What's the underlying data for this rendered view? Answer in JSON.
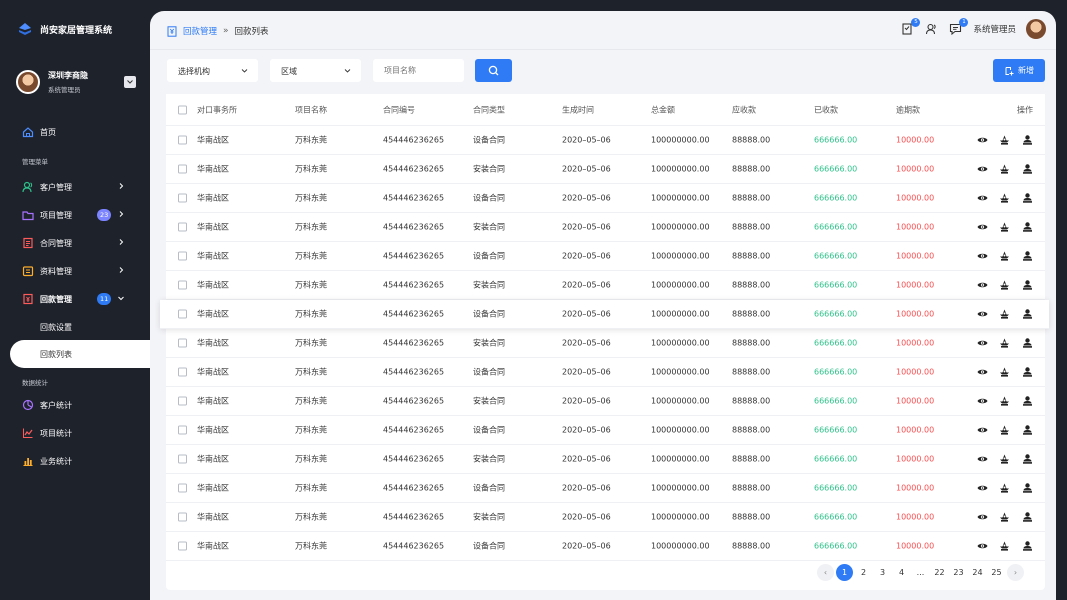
{
  "app": {
    "title": "尚安家居管理系统"
  },
  "user": {
    "name": "深圳李商隐",
    "role": "系统管理员"
  },
  "sidebar": {
    "home": "首页",
    "section_manage": "管理菜单",
    "items": [
      {
        "label": "客户管理",
        "badge": ""
      },
      {
        "label": "项目管理",
        "badge": "23"
      },
      {
        "label": "合同管理",
        "badge": ""
      },
      {
        "label": "资料管理",
        "badge": ""
      },
      {
        "label": "回款管理",
        "badge": "11"
      }
    ],
    "sub_items": [
      "回款设置",
      "回款列表"
    ],
    "section_stats": "数据统计",
    "stats_items": [
      "客户统计",
      "项目统计",
      "业务统计"
    ]
  },
  "breadcrumb": {
    "parent": "回款管理",
    "current": "回款列表"
  },
  "topbar": {
    "badge_a": "5",
    "badge_b": "1",
    "admin_name": "系统管理员"
  },
  "filters": {
    "org": "选择机构",
    "region": "区域",
    "project_placeholder": "项目名称",
    "add_label": "新增"
  },
  "table": {
    "headers": [
      "对口事务所",
      "项目名称",
      "合同编号",
      "合同类型",
      "生成时间",
      "总金额",
      "应收款",
      "已收款",
      "逾期款",
      "操作"
    ],
    "rows": [
      [
        "华南战区",
        "万科东莞",
        "454446236265",
        "设备合同",
        "2020–05–06",
        "100000000.00",
        "88888.00",
        "666666.00",
        "10000.00"
      ],
      [
        "华南战区",
        "万科东莞",
        "454446236265",
        "安装合同",
        "2020–05–06",
        "100000000.00",
        "88888.00",
        "666666.00",
        "10000.00"
      ],
      [
        "华南战区",
        "万科东莞",
        "454446236265",
        "设备合同",
        "2020–05–06",
        "100000000.00",
        "88888.00",
        "666666.00",
        "10000.00"
      ],
      [
        "华南战区",
        "万科东莞",
        "454446236265",
        "安装合同",
        "2020–05–06",
        "100000000.00",
        "88888.00",
        "666666.00",
        "10000.00"
      ],
      [
        "华南战区",
        "万科东莞",
        "454446236265",
        "设备合同",
        "2020–05–06",
        "100000000.00",
        "88888.00",
        "666666.00",
        "10000.00"
      ],
      [
        "华南战区",
        "万科东莞",
        "454446236265",
        "安装合同",
        "2020–05–06",
        "100000000.00",
        "88888.00",
        "666666.00",
        "10000.00"
      ],
      [
        "华南战区",
        "万科东莞",
        "454446236265",
        "设备合同",
        "2020–05–06",
        "100000000.00",
        "88888.00",
        "666666.00",
        "10000.00"
      ],
      [
        "华南战区",
        "万科东莞",
        "454446236265",
        "安装合同",
        "2020–05–06",
        "100000000.00",
        "88888.00",
        "666666.00",
        "10000.00"
      ],
      [
        "华南战区",
        "万科东莞",
        "454446236265",
        "设备合同",
        "2020–05–06",
        "100000000.00",
        "88888.00",
        "666666.00",
        "10000.00"
      ],
      [
        "华南战区",
        "万科东莞",
        "454446236265",
        "安装合同",
        "2020–05–06",
        "100000000.00",
        "88888.00",
        "666666.00",
        "10000.00"
      ],
      [
        "华南战区",
        "万科东莞",
        "454446236265",
        "设备合同",
        "2020–05–06",
        "100000000.00",
        "88888.00",
        "666666.00",
        "10000.00"
      ],
      [
        "华南战区",
        "万科东莞",
        "454446236265",
        "安装合同",
        "2020–05–06",
        "100000000.00",
        "88888.00",
        "666666.00",
        "10000.00"
      ],
      [
        "华南战区",
        "万科东莞",
        "454446236265",
        "设备合同",
        "2020–05–06",
        "100000000.00",
        "88888.00",
        "666666.00",
        "10000.00"
      ],
      [
        "华南战区",
        "万科东莞",
        "454446236265",
        "安装合同",
        "2020–05–06",
        "100000000.00",
        "88888.00",
        "666666.00",
        "10000.00"
      ],
      [
        "华南战区",
        "万科东莞",
        "454446236265",
        "设备合同",
        "2020–05–06",
        "100000000.00",
        "88888.00",
        "666666.00",
        "10000.00"
      ]
    ],
    "highlighted_row": 6,
    "actions": [
      "eye-icon",
      "remind-icon",
      "user-icon"
    ]
  },
  "pagination": {
    "pages": [
      "1",
      "2",
      "3",
      "4",
      "...",
      "22",
      "23",
      "24",
      "25"
    ],
    "current": "1",
    "prev": "‹",
    "next": "›"
  },
  "colors": {
    "accent": "#2f7bf6",
    "sidebar_bg": "#1e222b",
    "received": "#2ec28b",
    "overdue": "#ff4d4f"
  }
}
